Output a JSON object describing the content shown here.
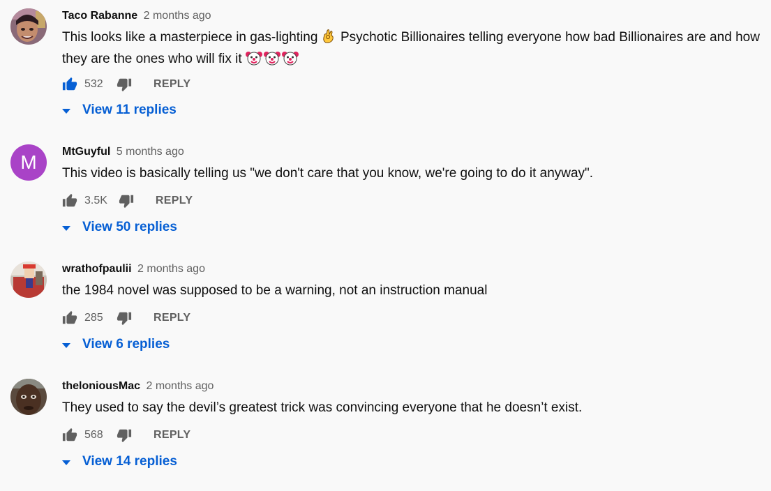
{
  "comments": [
    {
      "author": "Taco Rabanne",
      "time": "2 months ago",
      "text_before": "This looks like a masterpiece in gas-lighting",
      "text_after": " Psychotic Billionaires telling everyone how bad Billionaires are and how they are the ones who will fix it",
      "inline_emoji": "ok-hand-emoji",
      "trailing_emojis": [
        "clown-emoji",
        "clown-emoji",
        "clown-emoji"
      ],
      "likes": "532",
      "liked": true,
      "reply_label": "REPLY",
      "view_replies": "View 11 replies",
      "avatar": "photo-avatar",
      "avatar_color": "#7a5a6a"
    },
    {
      "author": "MtGuyful",
      "time": "5 months ago",
      "text": "This video is basically telling us \"we don't care that you know, we're going to do it anyway\".",
      "likes": "3.5K",
      "liked": false,
      "reply_label": "REPLY",
      "view_replies": "View 50 replies",
      "avatar": "letter-avatar",
      "avatar_letter": "M",
      "avatar_color": "#a943c7"
    },
    {
      "author": "wrathofpaulii",
      "time": "2 months ago",
      "text": "the 1984 novel was supposed to be a warning, not an instruction manual",
      "likes": "285",
      "liked": false,
      "reply_label": "REPLY",
      "view_replies": "View 6 replies",
      "avatar": "photo-avatar",
      "avatar_color": "#9a4a44"
    },
    {
      "author": "theloniousMac",
      "time": "2 months ago",
      "text": "They used to say the devil’s greatest trick was convincing everyone that he doesn’t exist.",
      "likes": "568",
      "liked": false,
      "reply_label": "REPLY",
      "view_replies": "View 14 replies",
      "avatar": "photo-avatar",
      "avatar_color": "#4a3a30"
    }
  ],
  "colors": {
    "background": "#f9f9f9",
    "link_blue": "#065fd4",
    "secondary_text": "#606060",
    "like_active": "#065fd4",
    "icon_gray": "#606060"
  }
}
